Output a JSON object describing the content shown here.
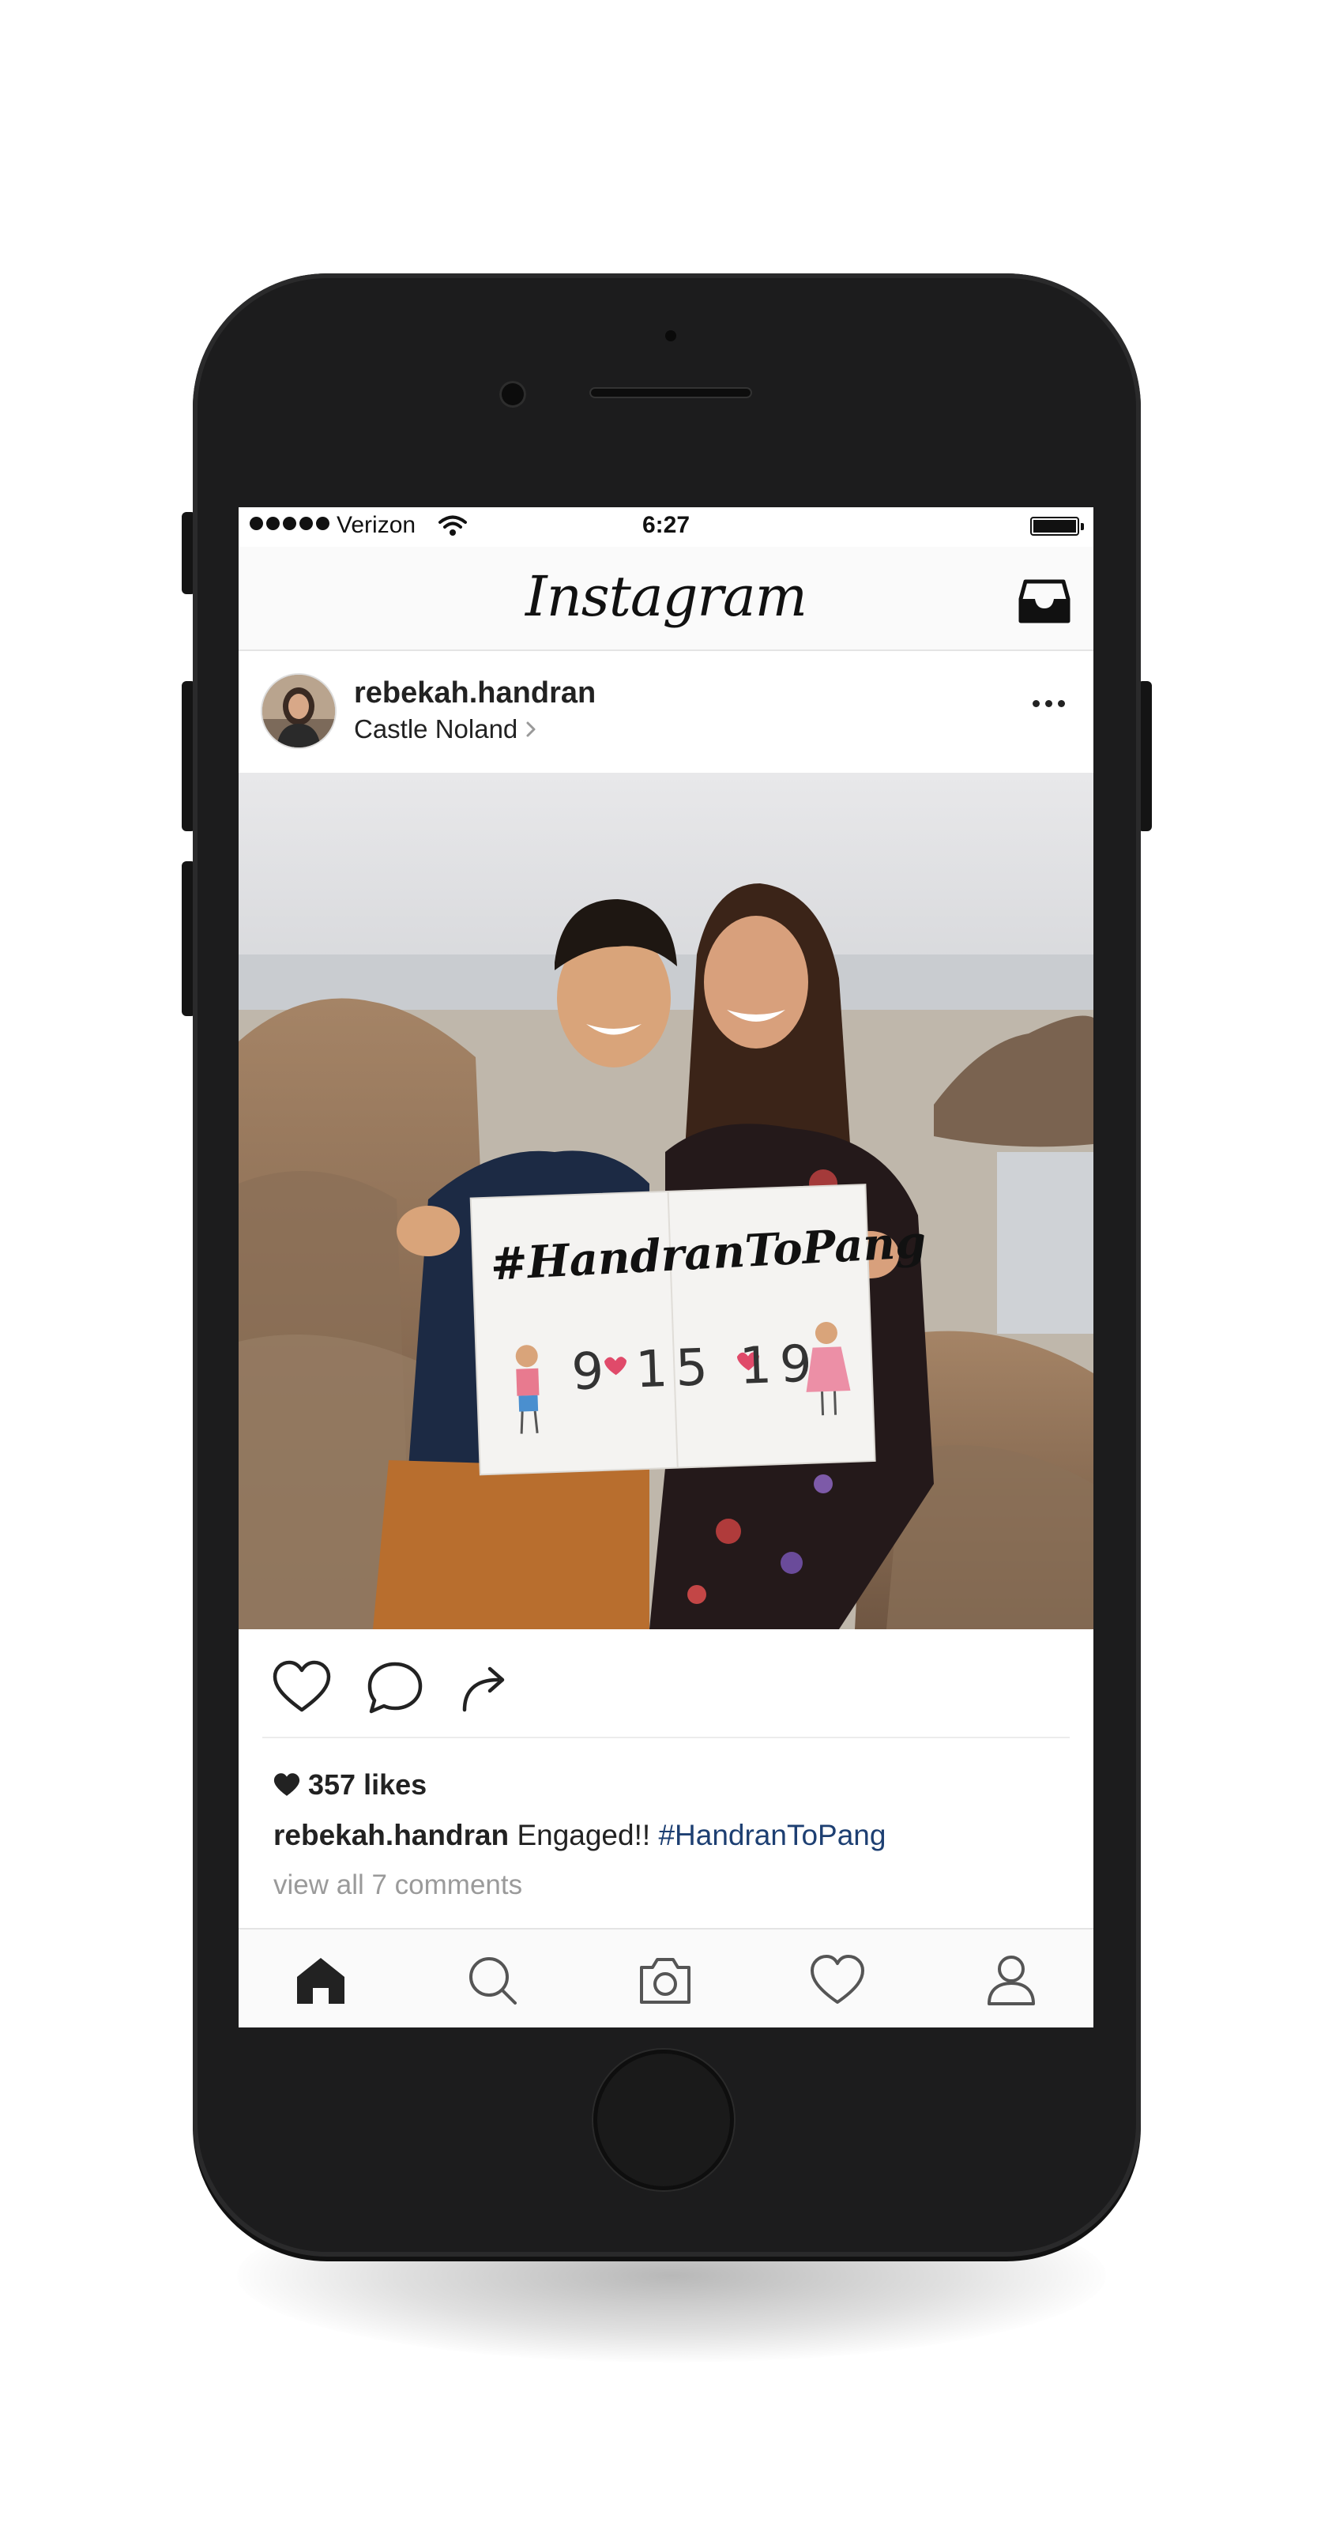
{
  "status_bar": {
    "carrier": "Verizon",
    "time": "6:27",
    "signal_icon": "signal-dots-icon",
    "wifi_icon": "wifi-icon",
    "battery_icon": "battery-icon"
  },
  "header": {
    "app_title": "Instagram",
    "inbox_icon": "inbox-tray-icon"
  },
  "post": {
    "username": "rebekah.handran",
    "location": "Castle Noland",
    "more_icon": "more-dots-icon",
    "photo_sign": {
      "hashtag": "#HandranToPang",
      "date": "9 15 19"
    },
    "actions": [
      "heart-icon",
      "comment-icon",
      "share-icon"
    ],
    "likes": "357 likes",
    "caption_user": "rebekah.handran",
    "caption_text": "Engaged!!",
    "caption_hashtag": "#HandranToPang",
    "view_comments": "view all 7 comments"
  },
  "tab_bar": {
    "items": [
      "home-icon",
      "search-icon",
      "camera-icon",
      "activity-heart-icon",
      "profile-icon"
    ],
    "active": "home-icon"
  },
  "colors": {
    "phone_body": "#1c1c1d",
    "hashtag_link": "#1d3f72",
    "muted_text": "#9a9a9a"
  }
}
